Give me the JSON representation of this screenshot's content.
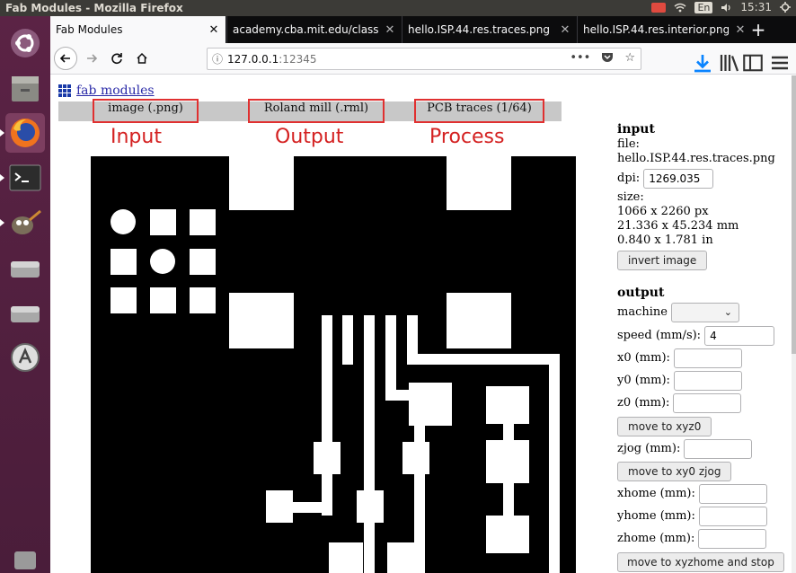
{
  "system": {
    "window_title": "Fab Modules - Mozilla Firefox",
    "language": "En",
    "time": "15:31"
  },
  "tabs": [
    {
      "label": "Fab Modules",
      "active": true
    },
    {
      "label": "academy.cba.mit.edu/class",
      "active": false
    },
    {
      "label": "hello.ISP.44.res.traces.png",
      "active": false
    },
    {
      "label": "hello.ISP.44.res.interior.png",
      "active": false
    }
  ],
  "nav": {
    "url_host": "127.0.0.1",
    "url_port": ":12345"
  },
  "page": {
    "logo_text": "fab modules",
    "menu": {
      "input": "image (.png)",
      "output": "Roland mill (.rml)",
      "process": "PCB traces (1/64)"
    },
    "captions": {
      "input": "Input",
      "output": "Output",
      "process": "Process"
    }
  },
  "panel": {
    "input_heading": "input",
    "file_label": "file:",
    "file_name": "hello.ISP.44.res.traces.png",
    "dpi_label": "dpi:",
    "dpi_value": "1269.035",
    "size_label": "size:",
    "size_px": "1066 x 2260 px",
    "size_mm": "21.336 x 45.234 mm",
    "size_in": "0.840 x 1.781 in",
    "invert_button": "invert image",
    "output_heading": "output",
    "machine_label": "machine",
    "speed_label": "speed (mm/s):",
    "speed_value": "4",
    "x0_label": "x0 (mm):",
    "y0_label": "y0 (mm):",
    "z0_label": "z0 (mm):",
    "move_xyz0_button": "move to xyz0",
    "zjog_label": "zjog (mm):",
    "move_xy0_zjog_button": "move to xy0 zjog",
    "xhome_label": "xhome (mm):",
    "yhome_label": "yhome (mm):",
    "zhome_label": "zhome (mm):",
    "move_home_button": "move to xyzhome and stop"
  },
  "colors": {
    "launcher": "#4a1d3a",
    "topbar": "#3c3b37",
    "annotation": "#e03030",
    "board": "#000000"
  }
}
